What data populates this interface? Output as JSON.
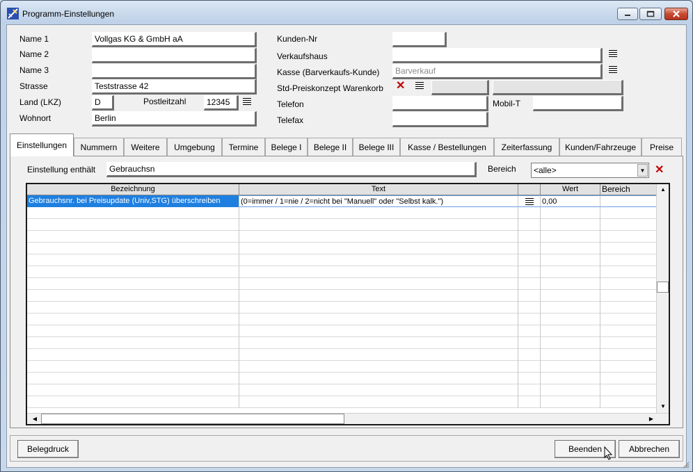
{
  "window": {
    "title": "Programm-Einstellungen"
  },
  "address": {
    "name1_label": "Name 1",
    "name1_value": "Vollgas KG & GmbH aA",
    "name2_label": "Name 2",
    "name2_value": "",
    "name3_label": "Name 3",
    "name3_value": "",
    "street_label": "Strasse",
    "street_value": "Teststrasse 42",
    "country_label": "Land (LKZ)",
    "country_value": "D",
    "zip_label": "Postleitzahl",
    "zip_value": "12345",
    "city_label": "Wohnort",
    "city_value": "Berlin"
  },
  "customer": {
    "customer_no_label": "Kunden-Nr",
    "customer_no_value": "",
    "store_label": "Verkaufshaus",
    "store_value": "",
    "cash_label": "Kasse (Barverkaufs-Kunde)",
    "cash_value": "Barverkauf",
    "price_label": "Std-Preiskonzept Warenkorb",
    "phone_label": "Telefon",
    "phone_value": "",
    "mobile_label": "Mobil-T",
    "mobile_value": "",
    "fax_label": "Telefax",
    "fax_value": ""
  },
  "tabs": [
    {
      "label": "Einstellungen",
      "active": true
    },
    {
      "label": "Nummern"
    },
    {
      "label": "Weitere"
    },
    {
      "label": "Umgebung"
    },
    {
      "label": "Termine"
    },
    {
      "label": "Belege I"
    },
    {
      "label": "Belege II"
    },
    {
      "label": "Belege III"
    },
    {
      "label": "Kasse / Bestellungen"
    },
    {
      "label": "Zeiterfassung"
    },
    {
      "label": "Kunden/Fahrzeuge"
    },
    {
      "label": "Preise"
    }
  ],
  "filter": {
    "contains_label": "Einstellung enthält",
    "contains_value": "Gebrauchsn",
    "area_label": "Bereich",
    "area_value": "<alle>"
  },
  "grid": {
    "columns": [
      "Bezeichnung",
      "Text",
      "",
      "Wert",
      "Bereich"
    ],
    "rows": [
      {
        "bezeichnung": "Gebrauchsnr. bei Preisupdate (Univ,STG) überschreiben",
        "text": "(0=immer / 1=nie / 2=nicht bei \"Manuell\" oder \"Selbst kalk.\")",
        "wert": "0,00",
        "bereich": ""
      }
    ]
  },
  "buttons": {
    "print": "Belegdruck",
    "finish": "Beenden",
    "cancel": "Abbrechen"
  },
  "colors": {
    "selection": "#1e7fe0",
    "delete_x": "#c00000",
    "close_button": "#c74a33"
  }
}
